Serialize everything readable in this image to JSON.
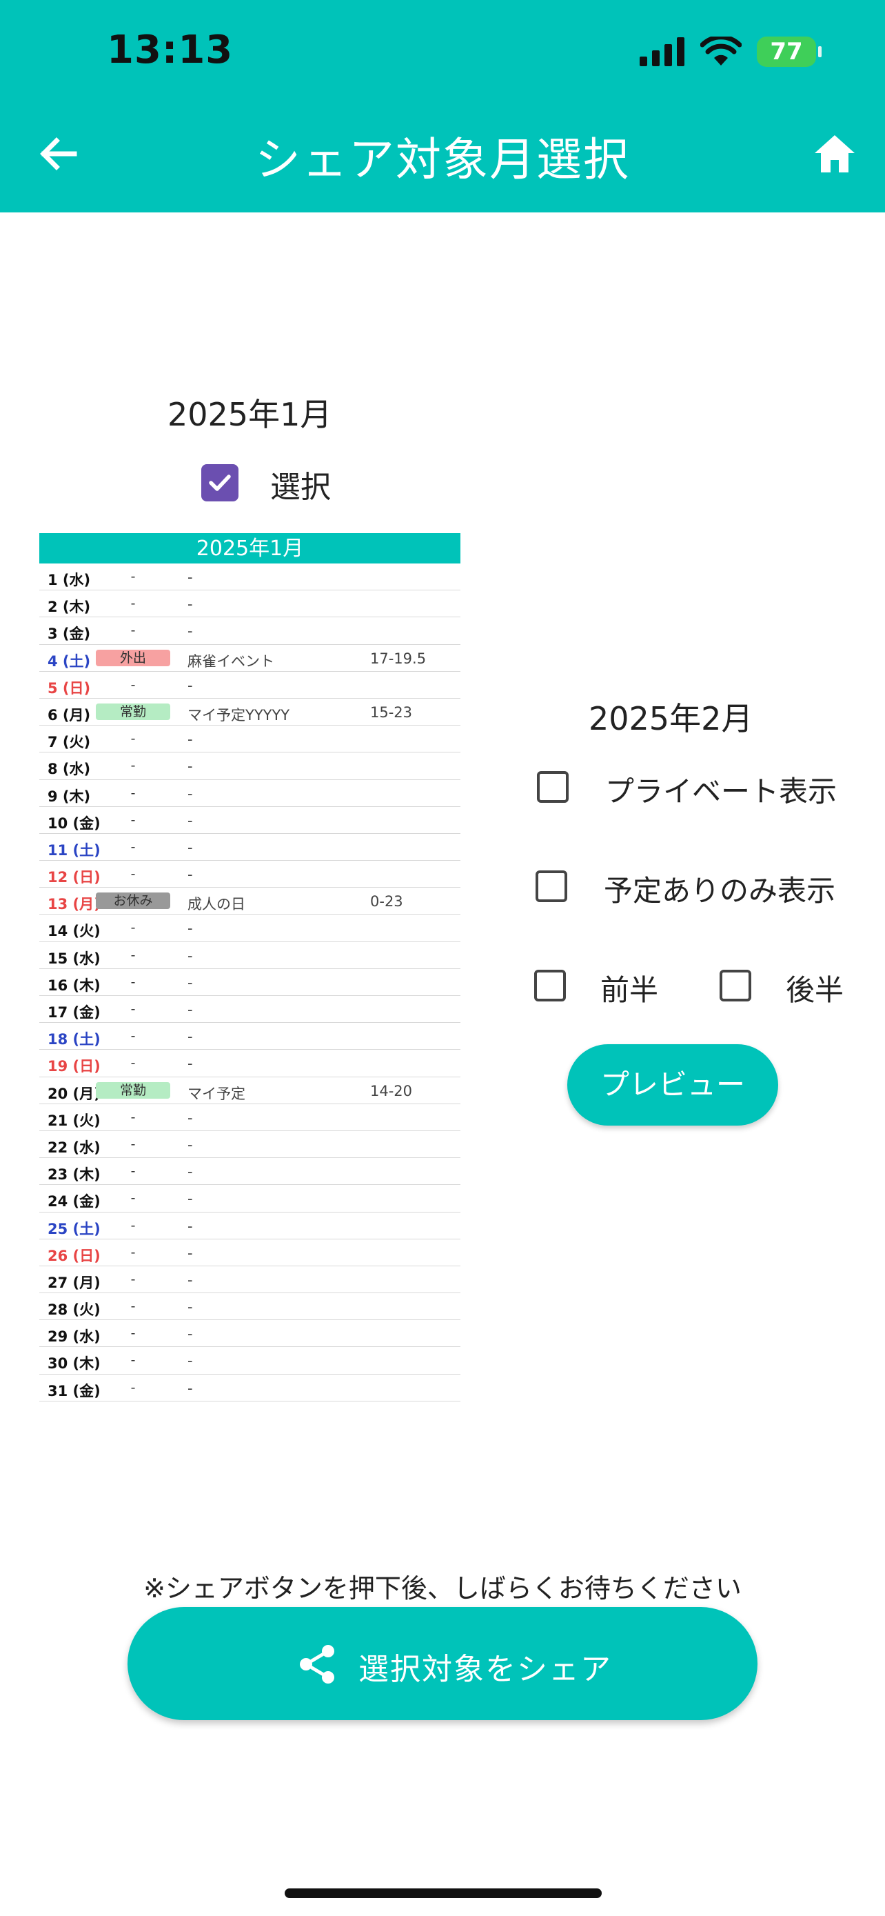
{
  "status_bar": {
    "time": "13:13",
    "battery": "77"
  },
  "header": {
    "title": "シェア対象月選択"
  },
  "january": {
    "heading": "2025年1月",
    "select_label": "選択",
    "selected": true,
    "calendar": {
      "title": "2025年1月",
      "rows": [
        {
          "day": "1 (水)",
          "tag": "-",
          "desc": "-",
          "time": "",
          "kind": "weekday",
          "tag_color": ""
        },
        {
          "day": "2 (木)",
          "tag": "-",
          "desc": "-",
          "time": "",
          "kind": "weekday",
          "tag_color": ""
        },
        {
          "day": "3 (金)",
          "tag": "-",
          "desc": "-",
          "time": "",
          "kind": "weekday",
          "tag_color": ""
        },
        {
          "day": "4 (土)",
          "tag": "外出",
          "desc": "麻雀イベント",
          "time": "17-19.5",
          "kind": "sat",
          "tag_color": "#f7a1a1"
        },
        {
          "day": "5 (日)",
          "tag": "-",
          "desc": "-",
          "time": "",
          "kind": "sun",
          "tag_color": ""
        },
        {
          "day": "6 (月)",
          "tag": "常勤",
          "desc": "マイ予定YYYYY",
          "time": "15-23",
          "kind": "weekday",
          "tag_color": "#b5ecc3"
        },
        {
          "day": "7 (火)",
          "tag": "-",
          "desc": "-",
          "time": "",
          "kind": "weekday",
          "tag_color": ""
        },
        {
          "day": "8 (水)",
          "tag": "-",
          "desc": "-",
          "time": "",
          "kind": "weekday",
          "tag_color": ""
        },
        {
          "day": "9 (木)",
          "tag": "-",
          "desc": "-",
          "time": "",
          "kind": "weekday",
          "tag_color": ""
        },
        {
          "day": "10 (金)",
          "tag": "-",
          "desc": "-",
          "time": "",
          "kind": "weekday",
          "tag_color": ""
        },
        {
          "day": "11 (土)",
          "tag": "-",
          "desc": "-",
          "time": "",
          "kind": "sat",
          "tag_color": ""
        },
        {
          "day": "12 (日)",
          "tag": "-",
          "desc": "-",
          "time": "",
          "kind": "sun",
          "tag_color": ""
        },
        {
          "day": "13 (月)",
          "tag": "お休み",
          "desc": "成人の日",
          "time": "0-23",
          "kind": "sun",
          "tag_color": "#999999"
        },
        {
          "day": "14 (火)",
          "tag": "-",
          "desc": "-",
          "time": "",
          "kind": "weekday",
          "tag_color": ""
        },
        {
          "day": "15 (水)",
          "tag": "-",
          "desc": "-",
          "time": "",
          "kind": "weekday",
          "tag_color": ""
        },
        {
          "day": "16 (木)",
          "tag": "-",
          "desc": "-",
          "time": "",
          "kind": "weekday",
          "tag_color": ""
        },
        {
          "day": "17 (金)",
          "tag": "-",
          "desc": "-",
          "time": "",
          "kind": "weekday",
          "tag_color": ""
        },
        {
          "day": "18 (土)",
          "tag": "-",
          "desc": "-",
          "time": "",
          "kind": "sat",
          "tag_color": ""
        },
        {
          "day": "19 (日)",
          "tag": "-",
          "desc": "-",
          "time": "",
          "kind": "sun",
          "tag_color": ""
        },
        {
          "day": "20 (月)",
          "tag": "常勤",
          "desc": "マイ予定",
          "time": "14-20",
          "kind": "weekday",
          "tag_color": "#b5ecc3"
        },
        {
          "day": "21 (火)",
          "tag": "-",
          "desc": "-",
          "time": "",
          "kind": "weekday",
          "tag_color": ""
        },
        {
          "day": "22 (水)",
          "tag": "-",
          "desc": "-",
          "time": "",
          "kind": "weekday",
          "tag_color": ""
        },
        {
          "day": "23 (木)",
          "tag": "-",
          "desc": "-",
          "time": "",
          "kind": "weekday",
          "tag_color": ""
        },
        {
          "day": "24 (金)",
          "tag": "-",
          "desc": "-",
          "time": "",
          "kind": "weekday",
          "tag_color": ""
        },
        {
          "day": "25 (土)",
          "tag": "-",
          "desc": "-",
          "time": "",
          "kind": "sat",
          "tag_color": ""
        },
        {
          "day": "26 (日)",
          "tag": "-",
          "desc": "-",
          "time": "",
          "kind": "sun",
          "tag_color": ""
        },
        {
          "day": "27 (月)",
          "tag": "-",
          "desc": "-",
          "time": "",
          "kind": "weekday",
          "tag_color": ""
        },
        {
          "day": "28 (火)",
          "tag": "-",
          "desc": "-",
          "time": "",
          "kind": "weekday",
          "tag_color": ""
        },
        {
          "day": "29 (水)",
          "tag": "-",
          "desc": "-",
          "time": "",
          "kind": "weekday",
          "tag_color": ""
        },
        {
          "day": "30 (木)",
          "tag": "-",
          "desc": "-",
          "time": "",
          "kind": "weekday",
          "tag_color": ""
        },
        {
          "day": "31 (金)",
          "tag": "-",
          "desc": "-",
          "time": "",
          "kind": "weekday",
          "tag_color": ""
        }
      ]
    }
  },
  "february": {
    "heading": "2025年2月",
    "options": {
      "private_label": "プライベート表示",
      "scheduled_only_label": "予定ありのみ表示",
      "first_half_label": "前半",
      "second_half_label": "後半"
    },
    "preview_label": "プレビュー"
  },
  "footer": {
    "notice": "※シェアボタンを押下後、しばらくお待ちください",
    "share_label": "選択対象をシェア"
  },
  "colors": {
    "accent": "#00c3b9",
    "checkbox": "#6b4fb0"
  }
}
